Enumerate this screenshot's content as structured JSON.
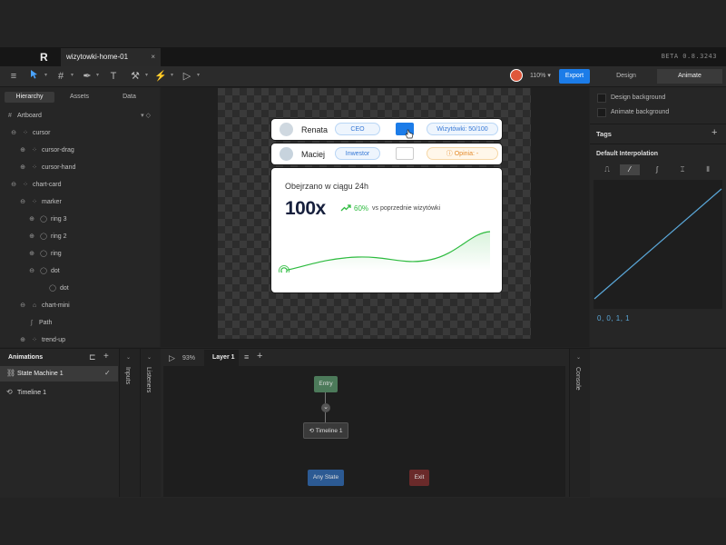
{
  "app": {
    "logo": "R",
    "tab_title": "wizytowki-home-01",
    "tab_close": "×",
    "version": "BETA 0.8.3243"
  },
  "toolbar": {
    "zoom": "110%",
    "export_label": "Export",
    "modes": [
      "Design",
      "Animate"
    ],
    "active_mode": "Animate"
  },
  "left_panel": {
    "tabs": [
      "Hierarchy",
      "Assets",
      "Data"
    ],
    "tree": [
      {
        "label": "Artboard",
        "depth": 0
      },
      {
        "label": "cursor",
        "depth": 1
      },
      {
        "label": "cursor-drag",
        "depth": 2
      },
      {
        "label": "cursor-hand",
        "depth": 2
      },
      {
        "label": "chart-card",
        "depth": 1
      },
      {
        "label": "marker",
        "depth": 2
      },
      {
        "label": "ring 3",
        "depth": 3
      },
      {
        "label": "ring 2",
        "depth": 3
      },
      {
        "label": "ring",
        "depth": 3
      },
      {
        "label": "dot",
        "depth": 3
      },
      {
        "label": "dot",
        "depth": 4
      },
      {
        "label": "chart-mini",
        "depth": 2
      },
      {
        "label": "Path",
        "depth": 3
      },
      {
        "label": "trend-up",
        "depth": 2
      }
    ]
  },
  "artboard": {
    "row1": {
      "name": "Renata",
      "role": "CEO",
      "stat": "Wizytówki: 50/100"
    },
    "row2": {
      "name": "Maciej",
      "role": "Inwestor",
      "stat": "Opinia: -",
      "stat_icon": "ⓘ"
    },
    "chart_card": {
      "title": "Obejrzano w ciągu 24h",
      "big_value": "100x",
      "delta": "60%",
      "delta_text": "vs poprzednie wizytówki"
    }
  },
  "right_panel": {
    "design_background": "Design background",
    "animate_background": "Animate background",
    "tags_label": "Tags",
    "tags_add": "+",
    "interpolation_label": "Default Interpolation",
    "interpolation_options": [
      "hold",
      "linear",
      "cubic",
      "elastic",
      "steps"
    ],
    "interpolation_active": "linear",
    "curve_values": "0, 0, 1, 1"
  },
  "animations": {
    "title": "Animations",
    "items": [
      "State Machine 1",
      "Timeline 1"
    ],
    "inputs_label": "Inputs",
    "listeners_label": "Listeners",
    "console_label": "Console",
    "graph_zoom": "93%",
    "layer_tab": "Layer 1",
    "nodes": {
      "entry": "Entry",
      "timeline": "Timeline 1",
      "any_state": "Any State",
      "exit": "Exit"
    }
  },
  "colors": {
    "accent": "#1c7ce8",
    "pill_blue": "#3779d6",
    "trend_green": "#2dbb3f",
    "entry_node": "#4c7a5a",
    "any_state_node": "#2c5a93",
    "exit_node": "#6a2a2a"
  }
}
